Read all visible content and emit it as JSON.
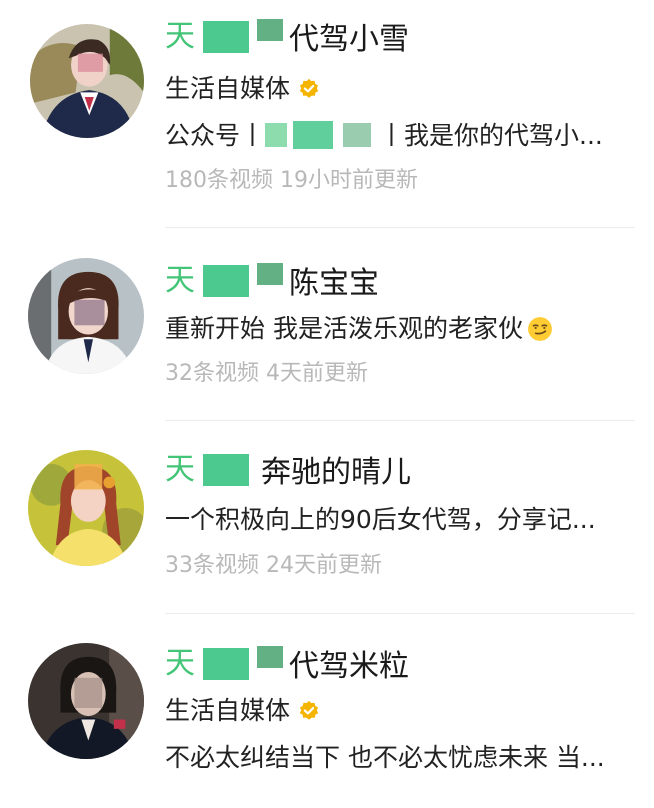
{
  "accounts": [
    {
      "name_prefix": "天",
      "name_suffix": "代驾小雪",
      "tag": "生活自媒体",
      "verified": true,
      "description": "公众号丨天    到丨我是你的代驾小...",
      "description_parts": [
        "公众号丨",
        "丨我是你的代驾小..."
      ],
      "video_count": "180条视频",
      "updated": "19小时前更新",
      "avatar_icon": "portrait-woman-suit-icon"
    },
    {
      "name_prefix": "天",
      "name_suffix": "陈宝宝",
      "description": "重新开始 我是活泼乐观的老家伙",
      "description_emoji": "smirk-emoji-icon",
      "video_count": "32条视频",
      "updated": "4天前更新",
      "avatar_icon": "portrait-woman-bob-hair-icon"
    },
    {
      "name_prefix": "天",
      "name_suffix": "奔驰的晴儿",
      "description": "一个积极向上的90后女代驾，分享记...",
      "video_count": "33条视频",
      "updated": "24天前更新",
      "avatar_icon": "portrait-woman-braids-icon"
    },
    {
      "name_prefix": "天",
      "name_suffix": "代驾米粒",
      "tag": "生活自媒体",
      "verified": true,
      "description": "不必太纠结当下 也不必太忧虑未来 当...",
      "avatar_icon": "portrait-woman-dark-icon"
    }
  ],
  "colors": {
    "highlight": "#2fbf6a",
    "verified": "#f5b400",
    "meta_text": "#b8b8b8",
    "divider": "#ececec"
  }
}
